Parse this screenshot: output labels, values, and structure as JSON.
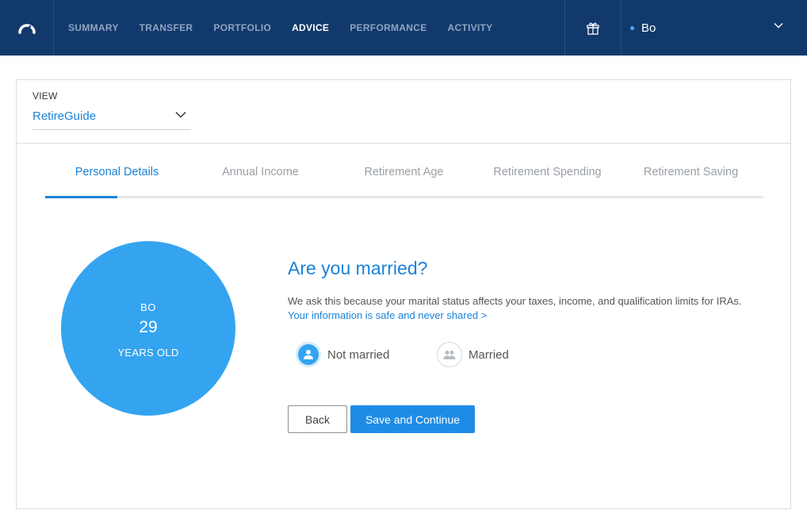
{
  "nav": {
    "items": [
      {
        "label": "SUMMARY",
        "active": false
      },
      {
        "label": "TRANSFER",
        "active": false
      },
      {
        "label": "PORTFOLIO",
        "active": false
      },
      {
        "label": "ADVICE",
        "active": true
      },
      {
        "label": "PERFORMANCE",
        "active": false
      },
      {
        "label": "ACTIVITY",
        "active": false
      }
    ],
    "user_name": "Bo",
    "logo_icon": "speedometer-icon",
    "gift_icon": "gift-icon"
  },
  "view": {
    "label": "VIEW",
    "selected": "RetireGuide"
  },
  "tabs": [
    {
      "label": "Personal Details",
      "active": true
    },
    {
      "label": "Annual Income",
      "active": false
    },
    {
      "label": "Retirement Age",
      "active": false
    },
    {
      "label": "Retirement Spending",
      "active": false
    },
    {
      "label": "Retirement Saving",
      "active": false
    }
  ],
  "profile": {
    "name": "BO",
    "age": "29",
    "age_unit": "YEARS OLD"
  },
  "question": {
    "title": "Are you married?",
    "description": "We ask this because your marital status affects your taxes, income, and qualification limits for IRAs.",
    "link": "Your information is safe and never shared >",
    "options": [
      {
        "label": "Not married",
        "selected": true,
        "icon": "person-icon"
      },
      {
        "label": "Married",
        "selected": false,
        "icon": "two-people-icon"
      }
    ]
  },
  "buttons": {
    "back": "Back",
    "save": "Save and Continue"
  },
  "colors": {
    "nav_bg": "#12396b",
    "accent": "#1b82d8",
    "circle": "#34a4f0"
  }
}
